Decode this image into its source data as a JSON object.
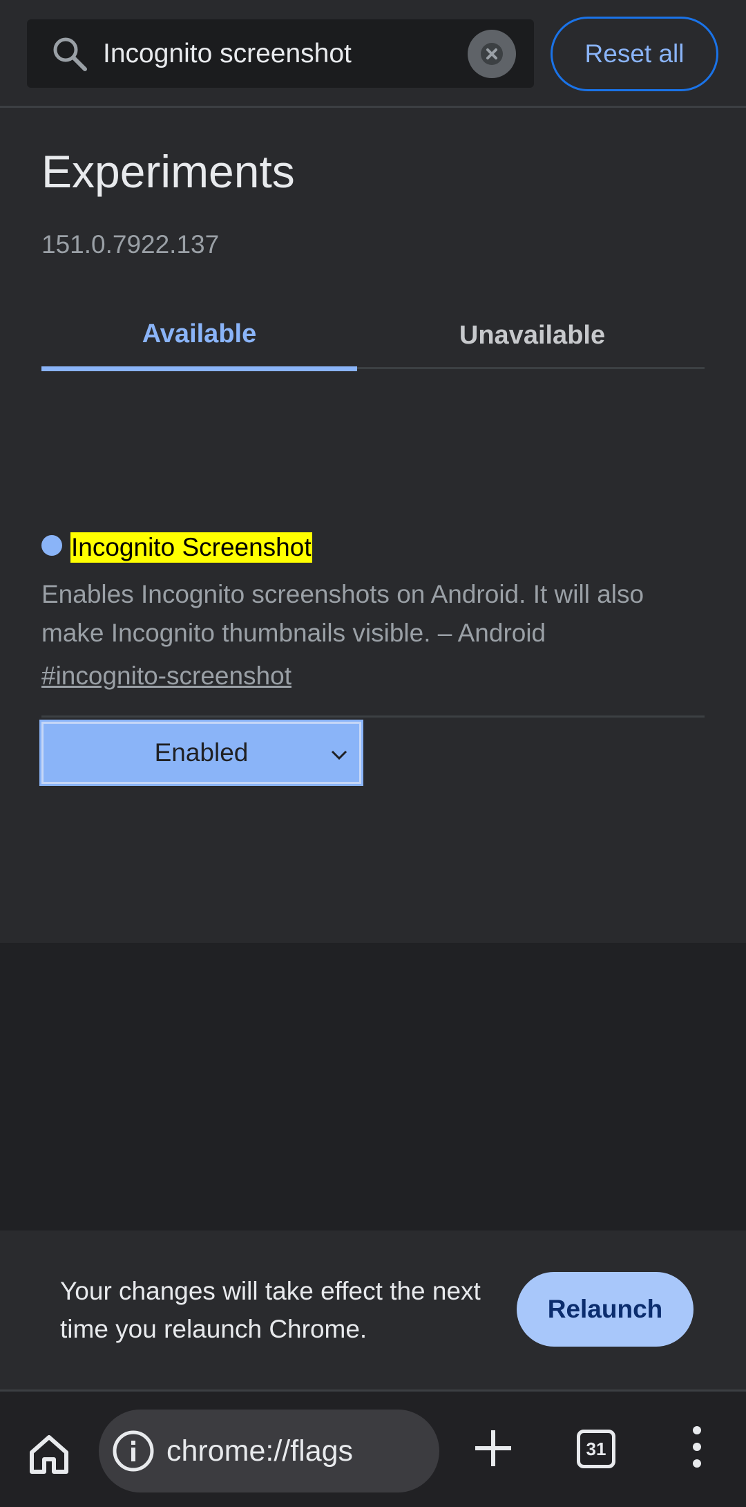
{
  "search": {
    "value": "Incognito screenshot",
    "placeholder": "Search flags",
    "reset_label": "Reset all"
  },
  "main": {
    "title": "Experiments",
    "version": "151.0.7922.137",
    "tabs": [
      {
        "label": "Available",
        "selected": true
      },
      {
        "label": "Unavailable",
        "selected": false
      }
    ],
    "experiments": [
      {
        "title": "Incognito Screenshot",
        "description": "Enables Incognito screenshots on Android. It will also make Incognito thumbnails visible. – Android",
        "link": "#incognito-screenshot",
        "selected_option": "Enabled"
      }
    ]
  },
  "snackbar": {
    "message": "Your changes will take effect the next time you relaunch Chrome.",
    "button_label": "Relaunch"
  },
  "toolbar": {
    "url": "chrome://flags",
    "tab_count": "31"
  },
  "colors": {
    "accent": "#8ab4f8",
    "background": "#292a2d",
    "highlight": "#ffff00",
    "relaunch_bg": "#a8c7fa"
  },
  "icons": [
    "search-icon",
    "clear-icon",
    "chevron-down-icon",
    "home-icon",
    "info-icon",
    "plus-icon",
    "tab-switcher-icon",
    "more-vert-icon"
  ]
}
